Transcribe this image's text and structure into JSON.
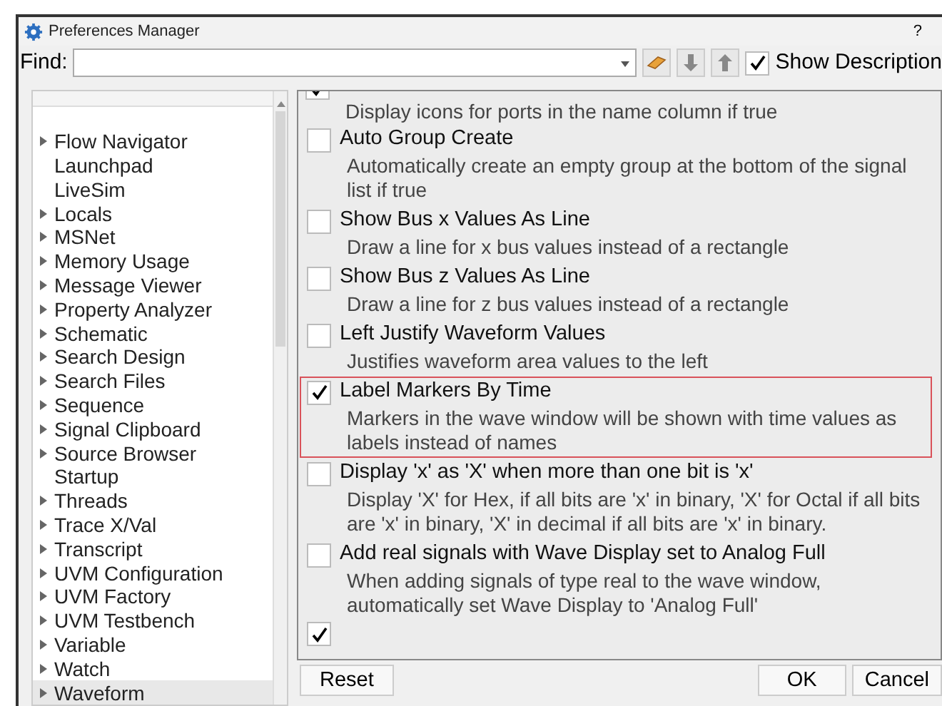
{
  "window": {
    "title": "Preferences Manager",
    "help": "?"
  },
  "find": {
    "label": "Find:",
    "show_description": {
      "label": "Show Description",
      "checked": true
    }
  },
  "tree": {
    "items": [
      {
        "label": "Flow Navigator",
        "kind": "branch",
        "selected": false
      },
      {
        "label": "Launchpad",
        "kind": "leaf",
        "selected": false
      },
      {
        "label": "LiveSim",
        "kind": "leaf",
        "selected": false
      },
      {
        "label": "Locals",
        "kind": "branch",
        "selected": false
      },
      {
        "label": "MSNet",
        "kind": "branch",
        "selected": false
      },
      {
        "label": "Memory Usage",
        "kind": "branch",
        "selected": false
      },
      {
        "label": "Message Viewer",
        "kind": "branch",
        "selected": false
      },
      {
        "label": "Property Analyzer",
        "kind": "branch",
        "selected": false
      },
      {
        "label": "Schematic",
        "kind": "branch",
        "selected": false
      },
      {
        "label": "Search Design",
        "kind": "branch",
        "selected": false
      },
      {
        "label": "Search Files",
        "kind": "branch",
        "selected": false
      },
      {
        "label": "Sequence",
        "kind": "branch",
        "selected": false
      },
      {
        "label": "Signal Clipboard",
        "kind": "branch",
        "selected": false
      },
      {
        "label": "Source Browser",
        "kind": "branch",
        "selected": false
      },
      {
        "label": "Startup",
        "kind": "leaf",
        "selected": false
      },
      {
        "label": "Threads",
        "kind": "branch",
        "selected": false
      },
      {
        "label": "Trace X/Val",
        "kind": "branch",
        "selected": false
      },
      {
        "label": "Transcript",
        "kind": "branch",
        "selected": false
      },
      {
        "label": "UVM Configuration",
        "kind": "branch",
        "selected": false
      },
      {
        "label": "UVM Factory",
        "kind": "branch",
        "selected": false
      },
      {
        "label": "UVM Testbench",
        "kind": "branch",
        "selected": false
      },
      {
        "label": "Variable",
        "kind": "branch",
        "selected": false
      },
      {
        "label": "Watch",
        "kind": "branch",
        "selected": false
      },
      {
        "label": "Waveform",
        "kind": "branch",
        "selected": true
      }
    ]
  },
  "preferences": [
    {
      "kind": "cut_top",
      "checked": true,
      "description": "Display icons for ports in the name column if true"
    },
    {
      "kind": "full",
      "title": "Auto Group Create",
      "checked": false,
      "selected": false,
      "description": "Automatically create an empty group at the bottom of the signal list if true"
    },
    {
      "kind": "full",
      "title": "Show Bus x Values As Line",
      "checked": false,
      "selected": false,
      "description": "Draw a line for x bus values instead of a rectangle"
    },
    {
      "kind": "full",
      "title": "Show Bus z Values As Line",
      "checked": false,
      "selected": false,
      "description": "Draw a line for z bus values instead of a rectangle"
    },
    {
      "kind": "full",
      "title": "Left Justify Waveform Values",
      "checked": false,
      "selected": false,
      "description": "Justifies waveform area values to the left"
    },
    {
      "kind": "full",
      "title": "Label Markers By Time",
      "checked": true,
      "selected": true,
      "description": "Markers in the wave window will be shown with time values as labels instead of names"
    },
    {
      "kind": "full",
      "title": "Display 'x' as 'X' when more than one bit is 'x'",
      "checked": false,
      "selected": false,
      "description": "Display 'X' for Hex, if all bits are 'x' in binary, 'X' for Octal if all bits are 'x' in binary, 'X' in decimal if all bits are 'x' in binary."
    },
    {
      "kind": "full",
      "title": "Add real signals with Wave Display set to Analog Full",
      "checked": false,
      "selected": false,
      "description": "When adding signals of type real to the wave window, automatically set Wave Display to 'Analog Full'"
    },
    {
      "kind": "cut_bottom",
      "checked": true
    }
  ],
  "buttons": {
    "reset": "Reset",
    "ok": "OK",
    "cancel": "Cancel"
  }
}
